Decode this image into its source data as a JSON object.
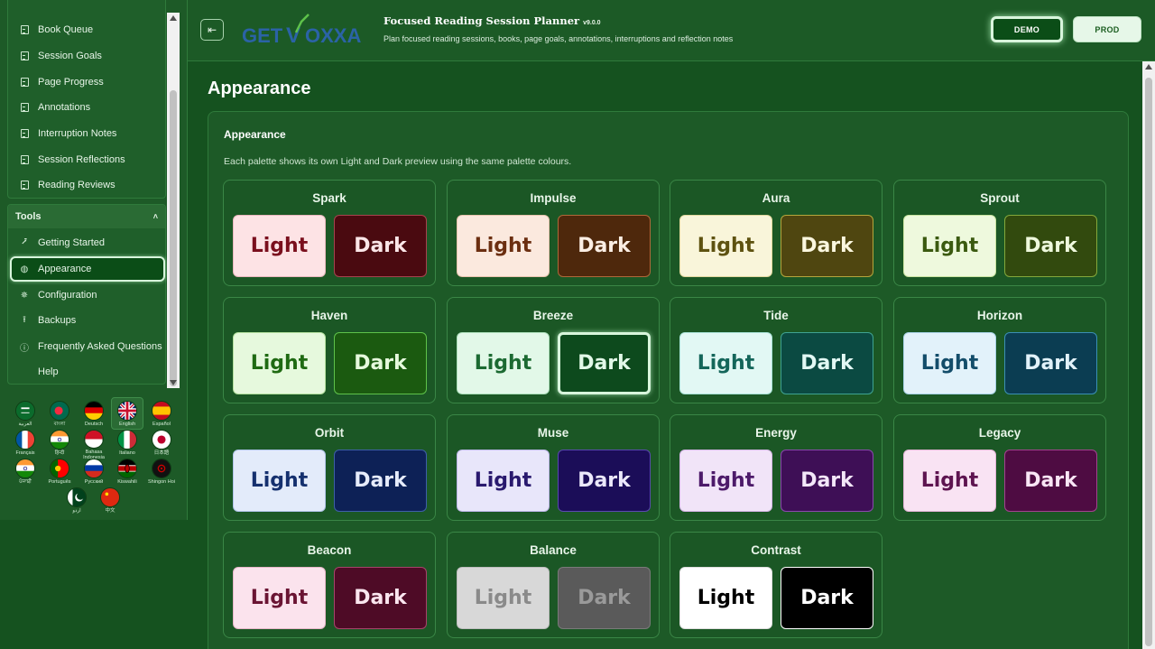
{
  "sidebar": {
    "nav_items": [
      {
        "label": "Book Queue",
        "icon": "document-icon"
      },
      {
        "label": "Session Goals",
        "icon": "document-icon"
      },
      {
        "label": "Page Progress",
        "icon": "document-icon"
      },
      {
        "label": "Annotations",
        "icon": "document-icon"
      },
      {
        "label": "Interruption Notes",
        "icon": "document-icon"
      },
      {
        "label": "Session Reflections",
        "icon": "document-icon"
      },
      {
        "label": "Reading Reviews",
        "icon": "document-icon"
      }
    ],
    "tools": {
      "title": "Tools",
      "toggle_glyph": "˄",
      "items": [
        {
          "label": "Getting Started",
          "glyph": "⭷"
        },
        {
          "label": "Appearance",
          "glyph": "◍"
        },
        {
          "label": "Configuration",
          "glyph": "✵"
        },
        {
          "label": "Backups",
          "glyph": "⭱"
        },
        {
          "label": "Frequently Asked Questions",
          "glyph": "ⓘ"
        },
        {
          "label": "Help",
          "glyph": ""
        }
      ]
    },
    "languages": [
      {
        "name": "العربية",
        "flag": "saudi-flag-icon"
      },
      {
        "name": "বাংলা",
        "flag": "bangladesh-flag-icon"
      },
      {
        "name": "Deutsch",
        "flag": "germany-flag-icon"
      },
      {
        "name": "English",
        "flag": "uk-flag-icon"
      },
      {
        "name": "Español",
        "flag": "spain-flag-icon"
      },
      {
        "name": "Français",
        "flag": "france-flag-icon"
      },
      {
        "name": "हिन्दी",
        "flag": "india-flag-icon"
      },
      {
        "name": "Bahasa Indonesia",
        "flag": "indonesia-flag-icon"
      },
      {
        "name": "Italiano",
        "flag": "italy-flag-icon"
      },
      {
        "name": "日本語",
        "flag": "japan-flag-icon"
      },
      {
        "name": "ਪੰਜਾਬੀ",
        "flag": "india-flag-icon"
      },
      {
        "name": "Português",
        "flag": "portugal-flag-icon"
      },
      {
        "name": "Русский",
        "flag": "russia-flag-icon"
      },
      {
        "name": "Kiswahili",
        "flag": "kenya-flag-icon"
      },
      {
        "name": "Shingon Hoi",
        "flag": "emblem-flag-icon"
      },
      {
        "name": "اردو",
        "flag": "pakistan-flag-icon"
      },
      {
        "name": "中文",
        "flag": "china-flag-icon"
      }
    ]
  },
  "header": {
    "toggle_glyph": "⇤",
    "logo_text_left": "GET",
    "logo_text_right": "OXXA",
    "logo_mark": "V",
    "title": "Focused Reading Session Planner",
    "version": "v9.0.0",
    "subtitle": "Plan focused reading sessions, books, page goals, annotations, interruptions and reflection notes",
    "demo_label": "DEMO",
    "prod_label": "PROD"
  },
  "main": {
    "page_title": "Appearance",
    "card_title": "Appearance",
    "card_description": "Each palette shows its own Light and Dark preview using the same palette colours.",
    "light_label": "Light",
    "dark_label": "Dark",
    "palettes": [
      {
        "name": "Spark",
        "light_bg": "#fde3e5",
        "light_fg": "#7a0f1d",
        "light_border": "#e8b7bd",
        "dark_bg": "#4a0a10",
        "dark_fg": "#fbe6e8",
        "dark_border": "#a7434e"
      },
      {
        "name": "Impulse",
        "light_bg": "#fbe9de",
        "light_fg": "#6b2e10",
        "light_border": "#e7c3ad",
        "dark_bg": "#4e280c",
        "dark_fg": "#fbeee4",
        "dark_border": "#b0683a"
      },
      {
        "name": "Aura",
        "light_bg": "#f9f5da",
        "light_fg": "#5e5210",
        "light_border": "#e2d89e",
        "dark_bg": "#4f4610",
        "dark_fg": "#fbf7df",
        "dark_border": "#b5a63d"
      },
      {
        "name": "Sprout",
        "light_bg": "#eef9dd",
        "light_fg": "#3b5a10",
        "light_border": "#c9e4a0",
        "dark_bg": "#324a0e",
        "dark_fg": "#eef9dd",
        "dark_border": "#84a83b"
      },
      {
        "name": "Haven",
        "light_bg": "#e6f9dd",
        "light_fg": "#1f6a12",
        "light_border": "#b3e09e",
        "dark_bg": "#1b5a10",
        "dark_fg": "#e6f9dd",
        "dark_border": "#5ec24a"
      },
      {
        "name": "Breeze",
        "light_bg": "#e2f8e8",
        "light_fg": "#1c6a32",
        "light_border": "#ade0bb",
        "dark_bg": "#0d4a1d",
        "dark_fg": "#e2f8e8",
        "dark_border": "#d8f5dc"
      },
      {
        "name": "Tide",
        "light_bg": "#e2f8f4",
        "light_fg": "#14665a",
        "light_border": "#a9e2d8",
        "dark_bg": "#0b4a42",
        "dark_fg": "#e2f8f4",
        "dark_border": "#3fa392"
      },
      {
        "name": "Horizon",
        "light_bg": "#e2f2fa",
        "light_fg": "#134d6a",
        "light_border": "#a8d2e6",
        "dark_bg": "#0b3d52",
        "dark_fg": "#e2f2fa",
        "dark_border": "#3b8fb4"
      },
      {
        "name": "Orbit",
        "light_bg": "#e3ebfa",
        "light_fg": "#15306e",
        "light_border": "#b0c3e8",
        "dark_bg": "#0d2156",
        "dark_fg": "#e6ecfb",
        "dark_border": "#3e5fa8"
      },
      {
        "name": "Muse",
        "light_bg": "#e8e6fa",
        "light_fg": "#29196e",
        "light_border": "#bdb6e8",
        "dark_bg": "#1b0d58",
        "dark_fg": "#ebe8fb",
        "dark_border": "#5a48b0"
      },
      {
        "name": "Energy",
        "light_bg": "#f1e4f8",
        "light_fg": "#4d1a6a",
        "light_border": "#d5b5e6",
        "dark_bg": "#3e0f56",
        "dark_fg": "#f3e7f9",
        "dark_border": "#8a48ad"
      },
      {
        "name": "Legacy",
        "light_bg": "#f9e3f3",
        "light_fg": "#5e1450",
        "light_border": "#e3b3d6",
        "dark_bg": "#4e0c42",
        "dark_fg": "#f9e6f5",
        "dark_border": "#a3428f"
      },
      {
        "name": "Beacon",
        "light_bg": "#fbe3ed",
        "light_fg": "#6a1433",
        "light_border": "#e6b5c8",
        "dark_bg": "#4e0b26",
        "dark_fg": "#fbe6ef",
        "dark_border": "#a8436b"
      },
      {
        "name": "Balance",
        "light_bg": "#d8d8d8",
        "light_fg": "#8a8a8a",
        "light_border": "#bdbdbd",
        "dark_bg": "#5a5a5a",
        "dark_fg": "#9a9a9a",
        "dark_border": "#7a7a7a"
      },
      {
        "name": "Contrast",
        "light_bg": "#ffffff",
        "light_fg": "#000000",
        "light_border": "#dddddd",
        "dark_bg": "#000000",
        "dark_fg": "#ffffff",
        "dark_border": "#ffffff"
      }
    ],
    "selected_palette": "Breeze",
    "selected_mode": "dark"
  }
}
